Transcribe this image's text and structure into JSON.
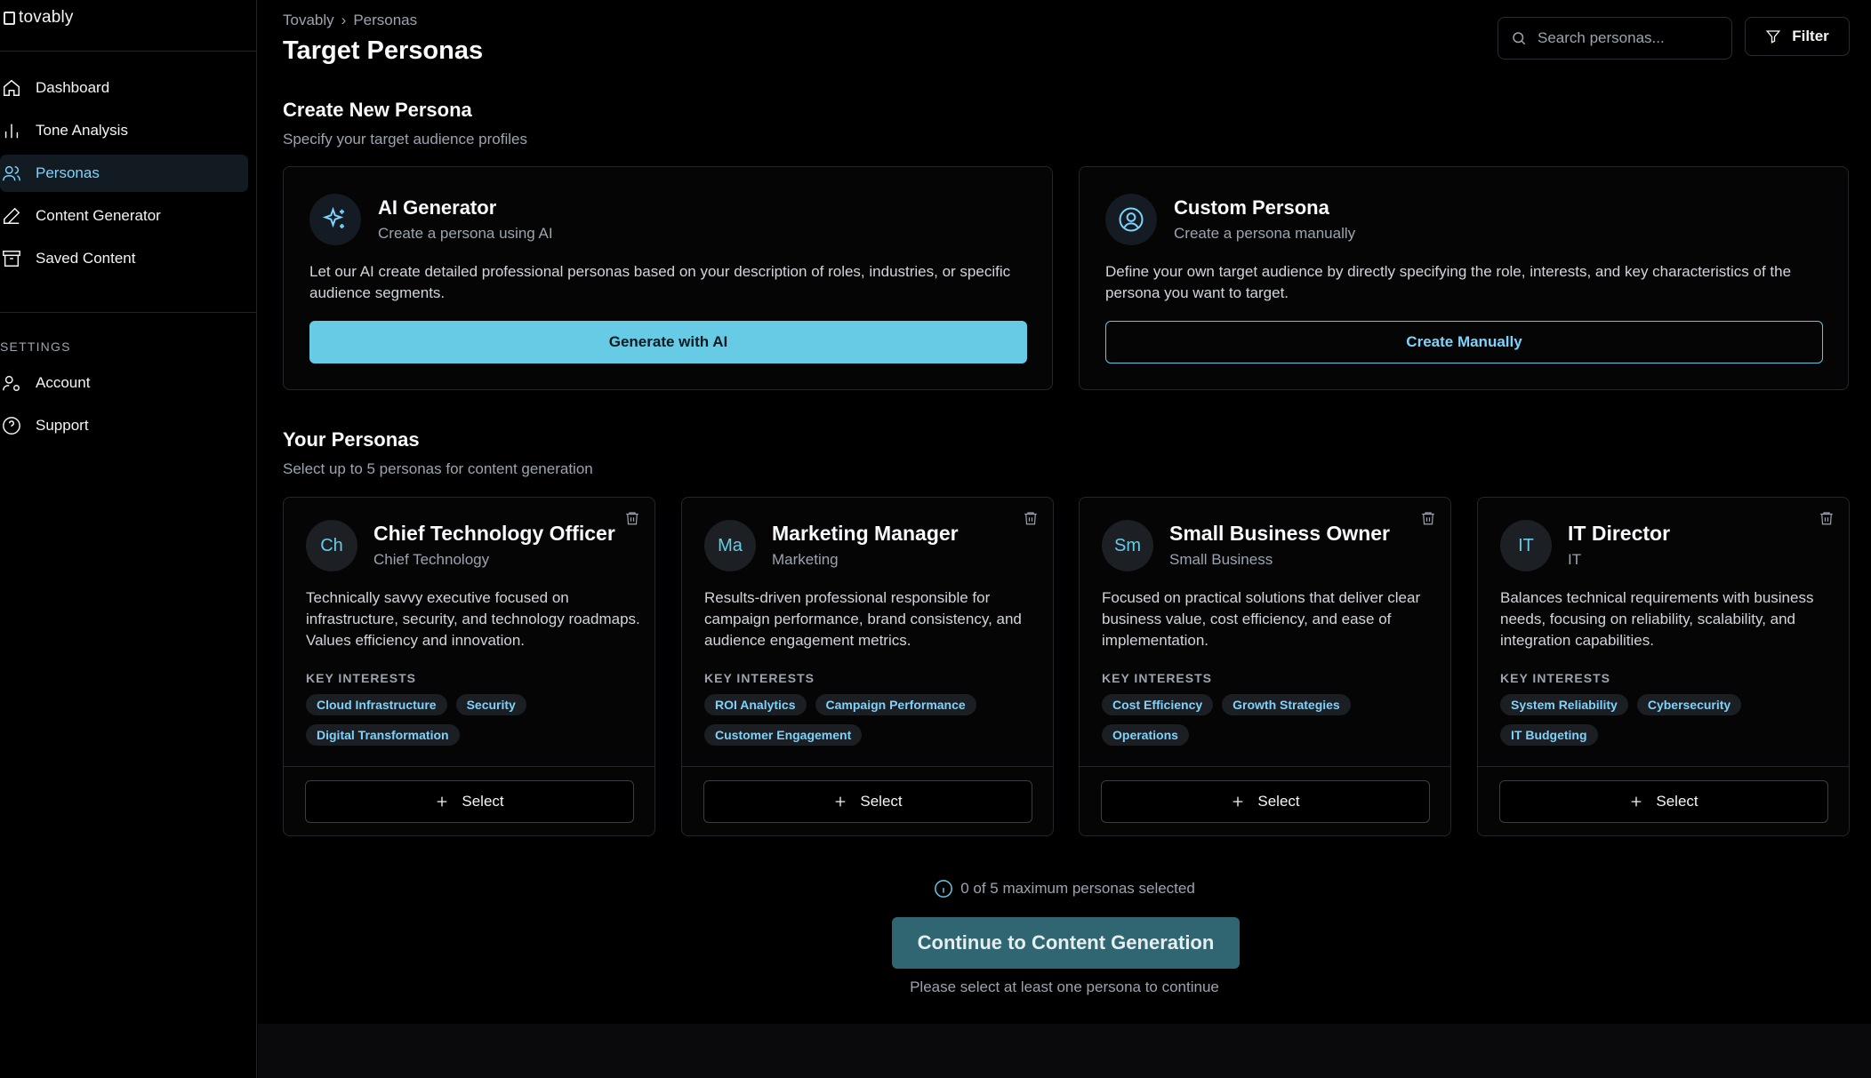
{
  "app": {
    "name": "tovably"
  },
  "sidebar": {
    "items": [
      {
        "label": "Dashboard",
        "icon": "home-icon",
        "active": false
      },
      {
        "label": "Tone Analysis",
        "icon": "bar-chart-icon",
        "active": false
      },
      {
        "label": "Personas",
        "icon": "users-icon",
        "active": true
      },
      {
        "label": "Content Generator",
        "icon": "pen-icon",
        "active": false
      },
      {
        "label": "Saved Content",
        "icon": "archive-icon",
        "active": false
      }
    ],
    "settings_heading": "SETTINGS",
    "settings_items": [
      {
        "label": "Account",
        "icon": "user-cog-icon"
      },
      {
        "label": "Support",
        "icon": "help-circle-icon"
      }
    ]
  },
  "header": {
    "breadcrumb": [
      "Tovably",
      "Personas"
    ],
    "breadcrumb_separator": "›",
    "title": "Target Personas",
    "search_placeholder": "Search personas...",
    "filter_label": "Filter"
  },
  "create": {
    "title": "Create New Persona",
    "subtitle": "Specify your target audience profiles",
    "ai": {
      "title": "AI Generator",
      "subtitle": "Create a persona using AI",
      "description": "Let our AI create detailed professional personas based on your description of roles, industries, or specific audience segments.",
      "button": "Generate with AI"
    },
    "custom": {
      "title": "Custom Persona",
      "subtitle": "Create a persona manually",
      "description": "Define your own target audience by directly specifying the role, interests, and key characteristics of the persona you want to target.",
      "button": "Create Manually"
    }
  },
  "personas": {
    "title": "Your Personas",
    "subtitle": "Select up to 5 personas for content generation",
    "interests_label": "KEY INTERESTS",
    "select_label": "Select",
    "items": [
      {
        "initials": "Ch",
        "title": "Chief Technology Officer",
        "subtitle": "Chief Technology",
        "description": "Technically savvy executive focused on infrastructure, security, and technology roadmaps. Values efficiency and innovation.",
        "tags": [
          "Cloud Infrastructure",
          "Security",
          "Digital Transformation"
        ]
      },
      {
        "initials": "Ma",
        "title": "Marketing Manager",
        "subtitle": "Marketing",
        "description": "Results-driven professional responsible for campaign performance, brand consistency, and audience engagement metrics.",
        "tags": [
          "ROI Analytics",
          "Campaign Performance",
          "Customer Engagement"
        ]
      },
      {
        "initials": "Sm",
        "title": "Small Business Owner",
        "subtitle": "Small Business",
        "description": "Focused on practical solutions that deliver clear business value, cost efficiency, and ease of implementation.",
        "tags": [
          "Cost Efficiency",
          "Growth Strategies",
          "Operations"
        ]
      },
      {
        "initials": "IT",
        "title": "IT Director",
        "subtitle": "IT",
        "description": "Balances technical requirements with business needs, focusing on reliability, scalability, and integration capabilities.",
        "tags": [
          "System Reliability",
          "Cybersecurity",
          "IT Budgeting"
        ]
      }
    ]
  },
  "footer": {
    "status": "0 of 5 maximum personas selected",
    "continue_button": "Continue to Content Generation",
    "helper": "Please select at least one persona to continue"
  },
  "colors": {
    "accent": "#67cbe6",
    "accent_text": "#7dd3fc",
    "background": "#000000",
    "card": "#050506",
    "continue_disabled": "#2f6671"
  }
}
